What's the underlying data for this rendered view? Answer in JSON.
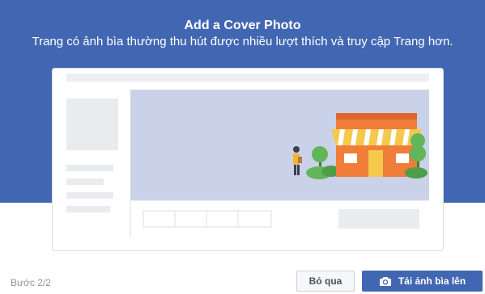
{
  "dialog": {
    "title": "Add a Cover Photo",
    "subtitle": "Trang có ảnh bìa thường thu hút được nhiều lượt thích và truy cập Trang hơn."
  },
  "footer": {
    "step": "Bước 2/2",
    "skip_label": "Bỏ qua",
    "upload_label": "Tải ảnh bìa lên",
    "upload_icon": "camera-icon"
  },
  "colors": {
    "brand_blue": "#4267b2",
    "cover_area": "#c9d2e9",
    "house_orange": "#f07d3a",
    "tree_green": "#62b65a"
  }
}
